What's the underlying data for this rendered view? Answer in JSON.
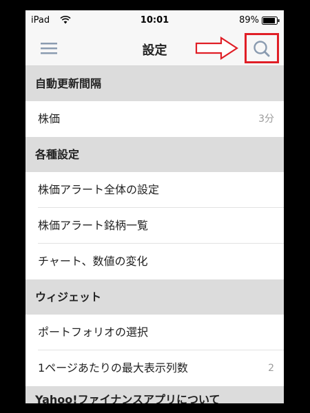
{
  "status_bar": {
    "carrier": "iPad",
    "time": "10:01",
    "battery": "89%"
  },
  "nav": {
    "title": "設定",
    "menu_icon": "hamburger-icon",
    "search_icon": "search-icon"
  },
  "sections": [
    {
      "header": "自動更新間隔",
      "rows": [
        {
          "label": "株価",
          "value": "3分"
        }
      ]
    },
    {
      "header": "各種設定",
      "rows": [
        {
          "label": "株価アラート全体の設定",
          "value": ""
        },
        {
          "label": "株価アラート銘柄一覧",
          "value": ""
        },
        {
          "label": "チャート、数値の変化",
          "value": ""
        }
      ]
    },
    {
      "header": "ウィジェット",
      "rows": [
        {
          "label": "ポートフォリオの選択",
          "value": ""
        },
        {
          "label": "1ページあたりの最大表示列数",
          "value": "2"
        }
      ]
    },
    {
      "header": "Yahoo!ファイナンスアプリについて",
      "rows": []
    }
  ],
  "colors": {
    "annotation": "#e01e26",
    "section_bg": "#dcdcdc",
    "icon": "#8a9bb0"
  }
}
